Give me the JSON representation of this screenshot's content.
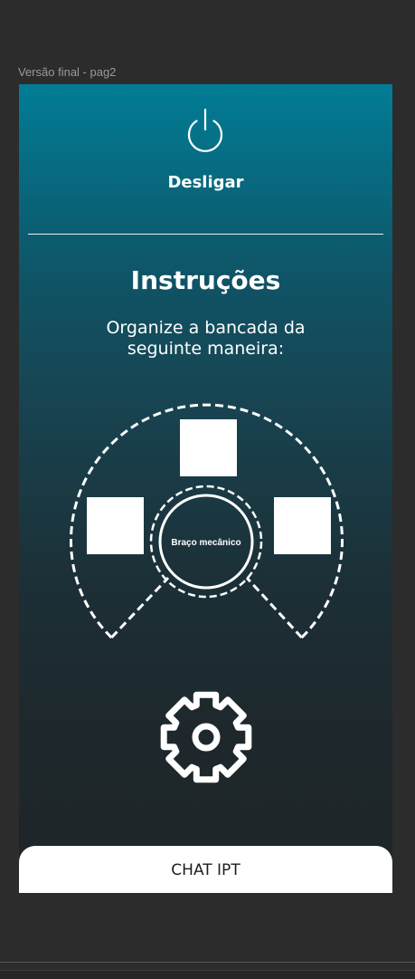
{
  "frame": {
    "label": "Versão final - pag2"
  },
  "header": {
    "power_icon": "power-icon",
    "power_label": "Desligar"
  },
  "instructions": {
    "title": "Instruções",
    "subtitle": "Organize a bancada da seguinte maneira:"
  },
  "diagram": {
    "center_label": "Braço mecânico"
  },
  "settings": {
    "icon": "gear-icon"
  },
  "footer": {
    "chat_label": "CHAT IPT"
  },
  "colors": {
    "gradient_top": "#017d96",
    "gradient_bottom": "#1e2629",
    "canvas_bg": "#2c2c2c",
    "chat_bg": "#ffffff"
  }
}
